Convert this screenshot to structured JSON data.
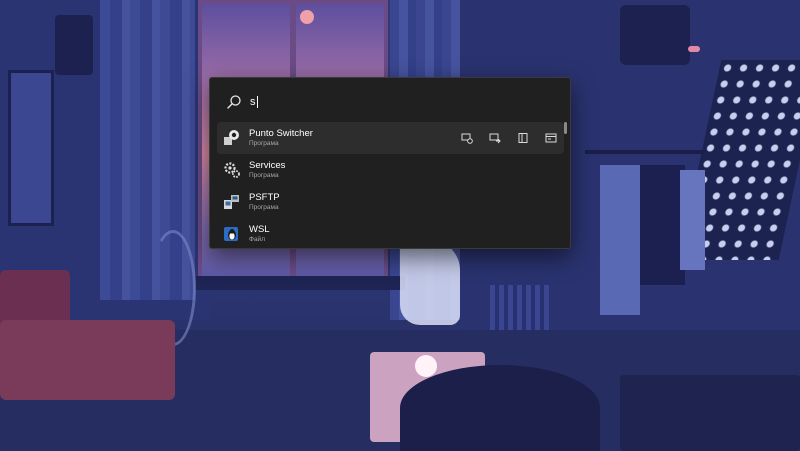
{
  "search": {
    "query": "s",
    "placeholder": ""
  },
  "results": [
    {
      "title": "Punto Switcher",
      "subtitle": "Програма",
      "icon": "punto-switcher-app-icon",
      "selected": true,
      "actions": [
        {
          "name": "run-as-admin-icon"
        },
        {
          "name": "run-as-other-user-icon"
        },
        {
          "name": "open-file-location-icon"
        },
        {
          "name": "open-in-terminal-icon"
        }
      ]
    },
    {
      "title": "Services",
      "subtitle": "Програма",
      "icon": "services-gear-icon",
      "selected": false
    },
    {
      "title": "PSFTP",
      "subtitle": "Програма",
      "icon": "psftp-app-icon",
      "selected": false
    },
    {
      "title": "WSL",
      "subtitle": "Файл",
      "icon": "wsl-penguin-icon",
      "selected": false
    }
  ],
  "colors": {
    "flyout_bg": "#202020",
    "selected_row_bg": "#2d2d2d",
    "text_primary": "#ffffff",
    "text_secondary": "#a8a8a8"
  }
}
